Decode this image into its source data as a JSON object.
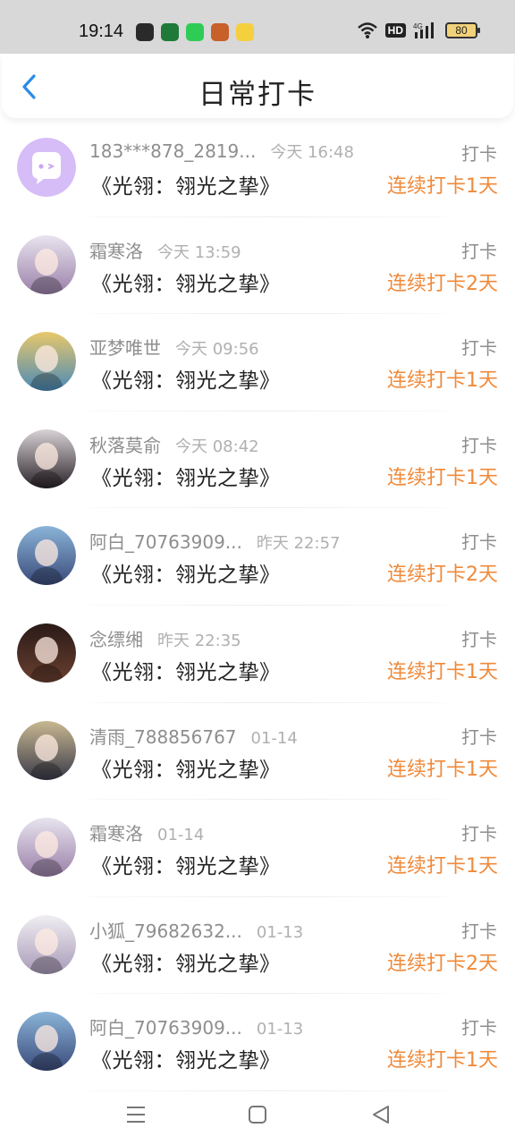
{
  "status_bar": {
    "time": "19:14",
    "notifications": [
      {
        "icon": "mask-app-icon",
        "color": "#2a2a2a"
      },
      {
        "icon": "oppo-app-icon",
        "color": "#1f7a3a"
      },
      {
        "icon": "green-app-icon",
        "color": "#2ecc55"
      },
      {
        "icon": "game-app-icon",
        "color": "#c8602a"
      },
      {
        "icon": "chat-app-icon",
        "color": "#f4d03f"
      }
    ],
    "hd_label": "HD",
    "network_label": "4G",
    "battery_level": "80"
  },
  "header": {
    "title": "日常打卡"
  },
  "colors": {
    "accent": "#2b8ce6",
    "streak": "#f08a3a"
  },
  "checkins": [
    {
      "user": "183***878_2819...",
      "time": "今天 16:48",
      "action": "打卡",
      "book": "《光翎：翎光之挚》",
      "streak": "连续打卡1天",
      "avatar": "default-placeholder",
      "avatar_colors": [
        "#d6bdf7",
        "#c9a8f2"
      ]
    },
    {
      "user": "霜寒洛",
      "time": "今天 13:59",
      "action": "打卡",
      "book": "《光翎：翎光之挚》",
      "streak": "连续打卡2天",
      "avatar": "anime-girl-silver-hair",
      "avatar_colors": [
        "#e8e4ef",
        "#9a7fa8"
      ]
    },
    {
      "user": "亚梦唯世",
      "time": "今天 09:56",
      "action": "打卡",
      "book": "《光翎：翎光之挚》",
      "streak": "连续打卡1天",
      "avatar": "anime-boy-blonde",
      "avatar_colors": [
        "#e8c86a",
        "#4a8ab8"
      ]
    },
    {
      "user": "秋落莫俞",
      "time": "今天 08:42",
      "action": "打卡",
      "book": "《光翎：翎光之挚》",
      "streak": "连续打卡1天",
      "avatar": "anime-dark-hair",
      "avatar_colors": [
        "#d8d2d6",
        "#2a2228"
      ]
    },
    {
      "user": "阿白_70763909...",
      "time": "昨天 22:57",
      "action": "打卡",
      "book": "《光翎：翎光之挚》",
      "streak": "连续打卡2天",
      "avatar": "anime-girl-hat",
      "avatar_colors": [
        "#8ab4d8",
        "#3a4a7a"
      ]
    },
    {
      "user": "念缥缃",
      "time": "昨天 22:35",
      "action": "打卡",
      "book": "《光翎：翎光之挚》",
      "streak": "连续打卡1天",
      "avatar": "dark-portrait",
      "avatar_colors": [
        "#2a1a18",
        "#6a4030"
      ]
    },
    {
      "user": "清雨_788856767",
      "time": "01-14",
      "action": "打卡",
      "book": "《光翎：翎光之挚》",
      "streak": "连续打卡1天",
      "avatar": "photo-figure",
      "avatar_colors": [
        "#c8b890",
        "#3a3a4a"
      ]
    },
    {
      "user": "霜寒洛",
      "time": "01-14",
      "action": "打卡",
      "book": "《光翎：翎光之挚》",
      "streak": "连续打卡1天",
      "avatar": "anime-girl-silver-hair",
      "avatar_colors": [
        "#e8e4ef",
        "#9a7fa8"
      ]
    },
    {
      "user": "小狐_79682632...",
      "time": "01-13",
      "action": "打卡",
      "book": "《光翎：翎光之挚》",
      "streak": "连续打卡2天",
      "avatar": "anime-girl-white",
      "avatar_colors": [
        "#f0eef2",
        "#a89ab8"
      ]
    },
    {
      "user": "阿白_70763909...",
      "time": "01-13",
      "action": "打卡",
      "book": "《光翎：翎光之挚》",
      "streak": "连续打卡1天",
      "avatar": "anime-girl-hat",
      "avatar_colors": [
        "#8ab4d8",
        "#3a4a7a"
      ]
    }
  ],
  "nav": {
    "buttons": [
      {
        "icon": "menu-icon"
      },
      {
        "icon": "home-icon"
      },
      {
        "icon": "back-triangle-icon"
      }
    ]
  }
}
